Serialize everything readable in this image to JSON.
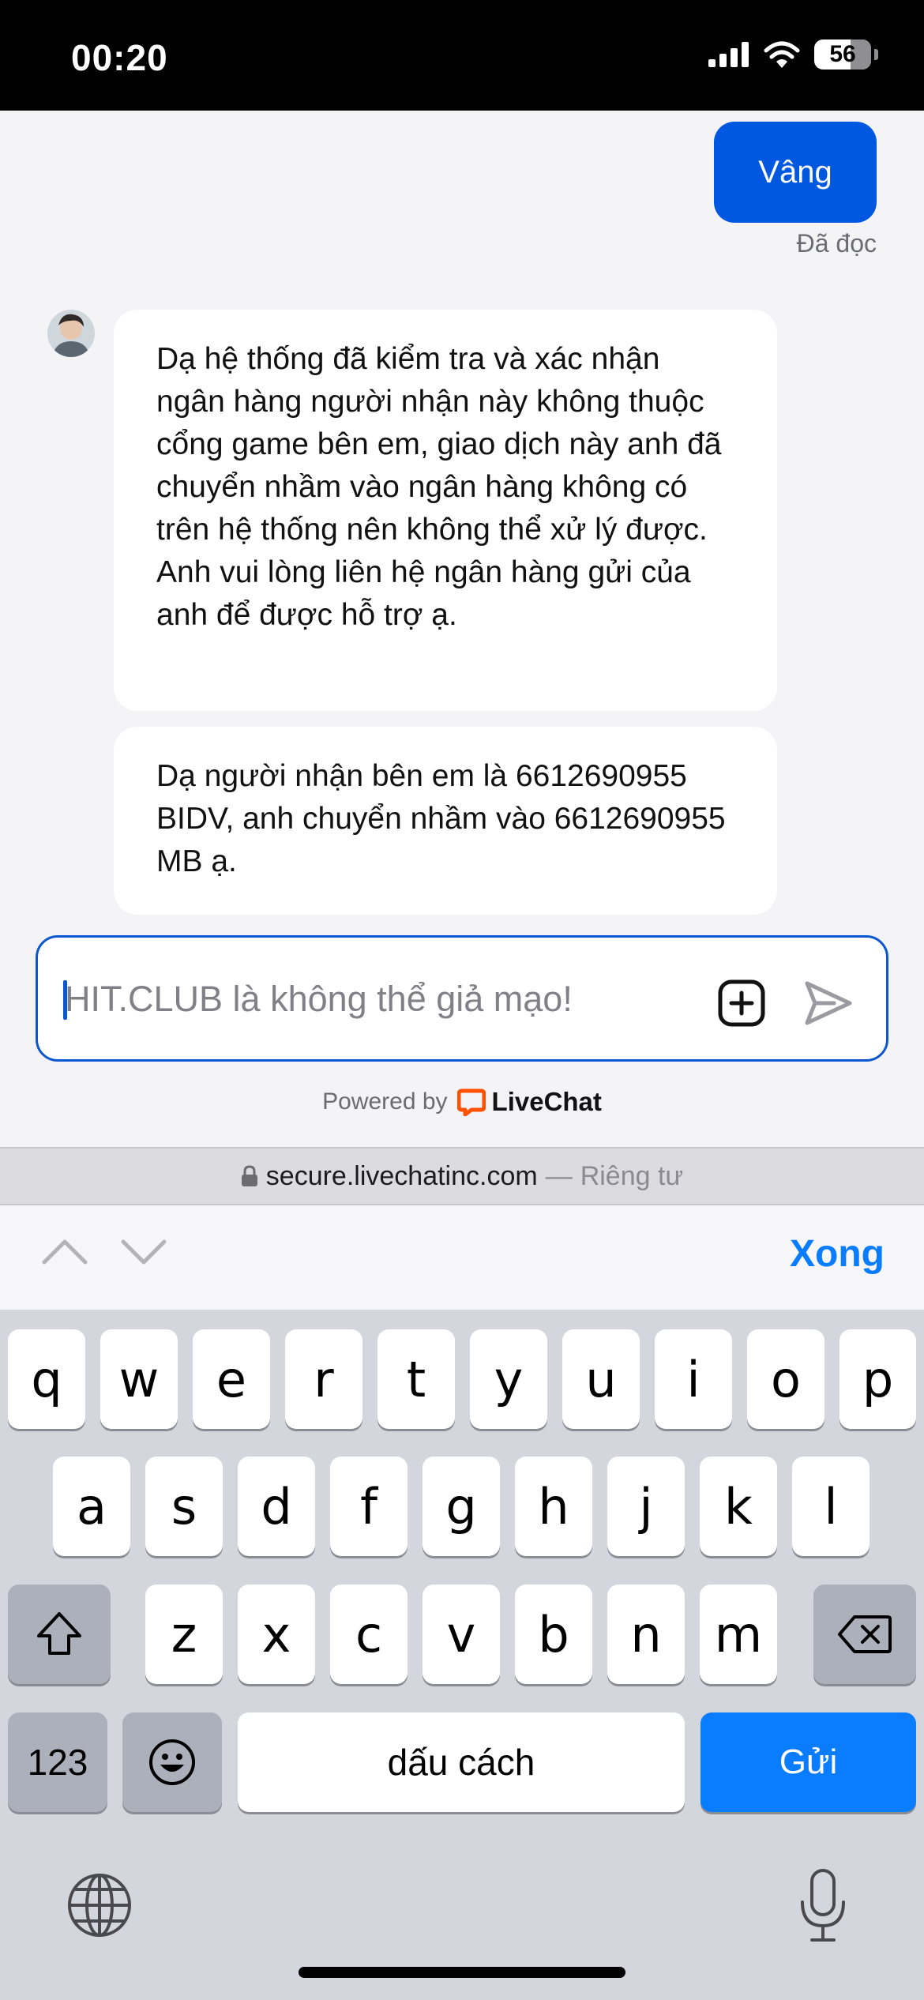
{
  "status_bar": {
    "time": "00:20",
    "battery": "56"
  },
  "chat": {
    "user_message": "Vâng",
    "read_status": "Đã đọc",
    "agent_messages": [
      "Dạ hệ thống đã kiểm tra và xác nhận ngân hàng người nhận này không thuộc cổng game bên em, giao dịch này anh đã chuyển nhầm vào ngân hàng không có trên hệ thống nên không thể xử lý được. Anh vui lòng liên hệ ngân hàng gửi của anh để được hỗ trợ ạ.",
      "Dạ người nhận bên em là 6612690955 BIDV, anh chuyển nhầm vào 6612690955 MB ạ."
    ]
  },
  "composer": {
    "placeholder": "HIT.CLUB là không thể giả mạo!"
  },
  "powered_by": {
    "label": "Powered by",
    "brand": "LiveChat"
  },
  "url_bar": {
    "domain": "secure.livechatinc.com",
    "separator": "—",
    "privacy": "Riêng tư"
  },
  "accessory_bar": {
    "done": "Xong"
  },
  "keyboard": {
    "row1": [
      "q",
      "w",
      "e",
      "r",
      "t",
      "y",
      "u",
      "i",
      "o",
      "p"
    ],
    "row2": [
      "a",
      "s",
      "d",
      "f",
      "g",
      "h",
      "j",
      "k",
      "l"
    ],
    "row3": [
      "z",
      "x",
      "c",
      "v",
      "b",
      "n",
      "m"
    ],
    "numbers_key": "123",
    "space_key": "dấu cách",
    "send_key": "Gửi"
  },
  "colors": {
    "accent": "#0b57d0",
    "user_bubble": "#0057e0",
    "ios_blue": "#0a7cff",
    "livechat_orange": "#ff5100"
  },
  "icons": [
    "signal-icon",
    "wifi-icon",
    "battery-icon",
    "lock-icon",
    "plus-square-icon",
    "send-icon",
    "livechat-logo-icon",
    "chevron-up-icon",
    "chevron-down-icon",
    "shift-icon",
    "backspace-icon",
    "emoji-icon",
    "globe-icon",
    "microphone-icon"
  ]
}
